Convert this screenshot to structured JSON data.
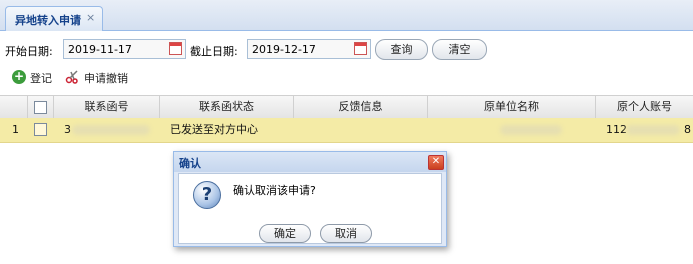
{
  "tab": {
    "label": "异地转入申请",
    "close": "×"
  },
  "filters": {
    "start_label": "开始日期:",
    "start_value": "2019-11-17",
    "end_label": "截止日期:",
    "end_value": "2019-12-17",
    "query_button": "查询",
    "clear_button": "清空"
  },
  "toolbar": {
    "register": "登记",
    "revoke": "申请撤销"
  },
  "grid": {
    "columns": [
      "联系函号",
      "联系函状态",
      "反馈信息",
      "原单位名称",
      "原个人账号"
    ],
    "rows": [
      {
        "index": "1",
        "letter_no": "3",
        "status": "已发送至对方中心",
        "feedback": "",
        "orig_unit": "",
        "orig_account_prefix": "112",
        "orig_account_suffix": "8"
      }
    ]
  },
  "dialog": {
    "title": "确认",
    "message": "确认取消该申请?",
    "ok": "确定",
    "cancel": "取消"
  },
  "colors": {
    "selected_row": "#f4eba6",
    "header_blue": "#15428b",
    "border_blue": "#99bbe8"
  }
}
